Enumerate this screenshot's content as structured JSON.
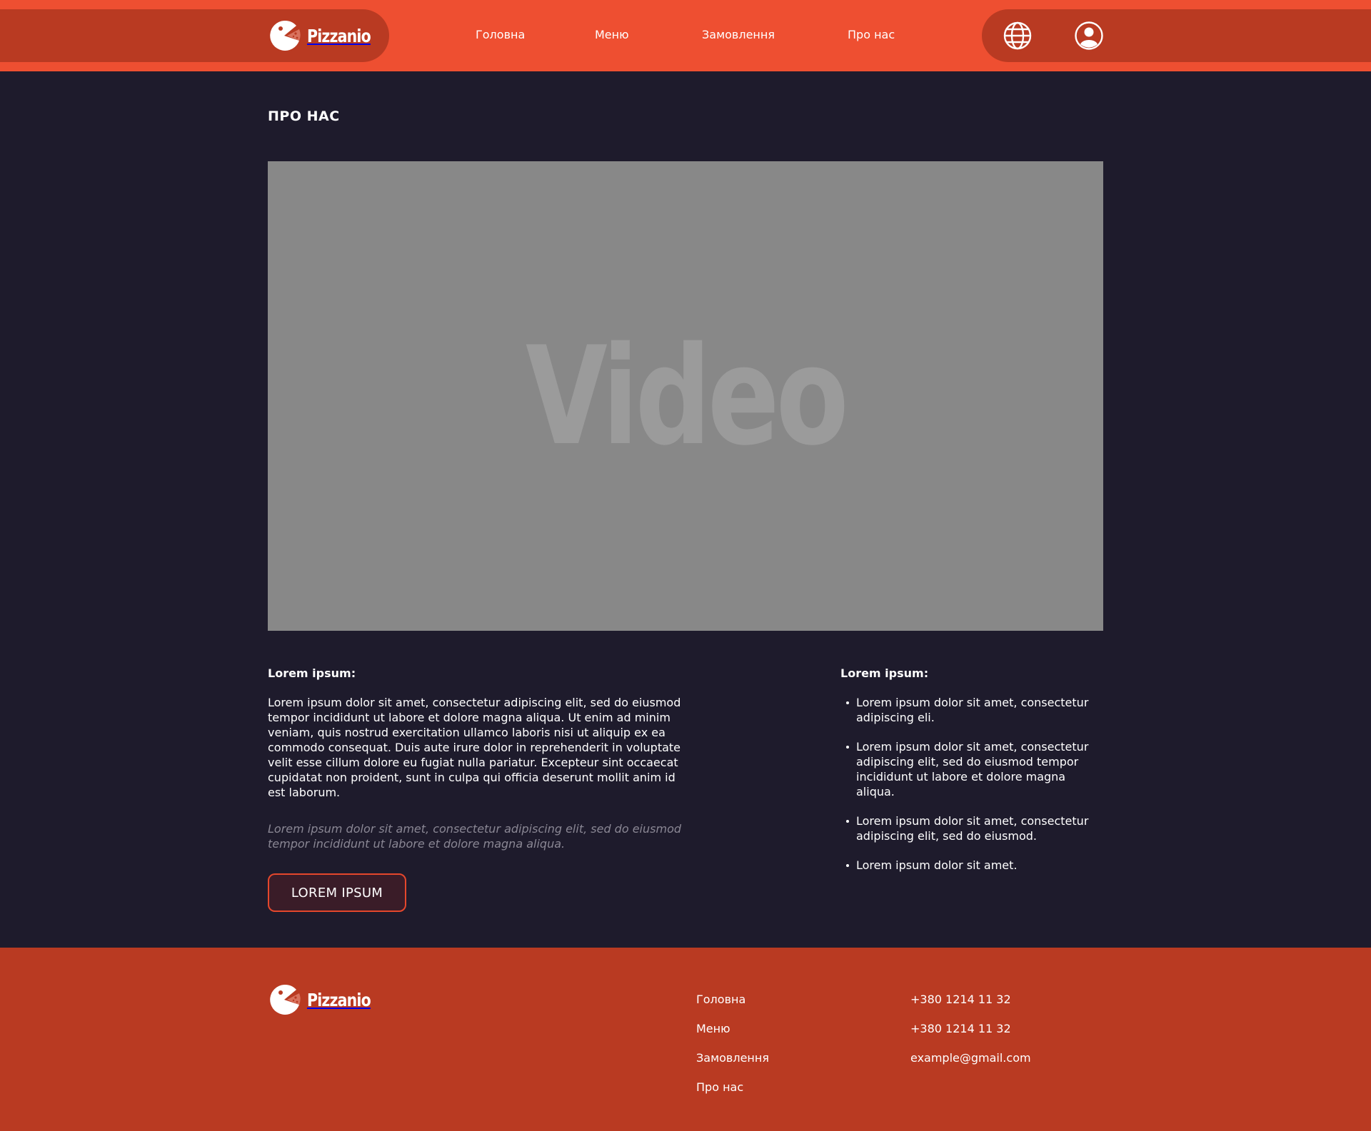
{
  "header": {
    "brand": "Pizzanio",
    "nav": [
      "Головна",
      "Меню",
      "Замовлення",
      "Про нас"
    ],
    "icons": [
      "globe-icon",
      "user-icon"
    ]
  },
  "main": {
    "page_title": "ПРО НАС",
    "video_label": "Video",
    "left": {
      "heading": "Lorem ipsum:",
      "paragraph": "Lorem ipsum dolor sit amet, consectetur adipiscing elit, sed do eiusmod tempor incididunt ut labore et dolore magna aliqua. Ut enim ad minim veniam, quis nostrud exercitation ullamco laboris nisi ut aliquip ex ea commodo consequat. Duis aute irure dolor in reprehenderit in voluptate velit esse cillum dolore eu fugiat nulla pariatur. Excepteur sint occaecat cupidatat non proident, sunt in culpa qui officia deserunt mollit anim id est laborum.",
      "italic_note": "Lorem ipsum dolor sit amet, consectetur adipiscing elit, sed do eiusmod tempor incididunt ut labore et dolore magna aliqua.",
      "button_label": "LOREM IPSUM"
    },
    "right": {
      "heading": "Lorem ipsum:",
      "items": [
        "Lorem ipsum dolor sit amet, consectetur adipiscing eli.",
        "Lorem ipsum dolor sit amet, consectetur adipiscing elit, sed do eiusmod tempor incididunt ut labore et dolore magna aliqua.",
        "Lorem ipsum dolor sit amet, consectetur adipiscing elit, sed do eiusmod.",
        "Lorem ipsum dolor sit amet."
      ]
    }
  },
  "footer": {
    "brand": "Pizzanio",
    "links": [
      "Головна",
      "Меню",
      "Замовлення",
      "Про нас"
    ],
    "contacts": [
      "+380 1214 11 32",
      "+380 1214 11 32",
      "example@gmail.com"
    ]
  },
  "colors": {
    "header_bg": "#ee4f31",
    "header_pill": "#b93a22",
    "page_bg": "#1e1b2c",
    "footer_bg": "#b93a22",
    "video_bg": "#888888",
    "accent": "#e5472c"
  }
}
